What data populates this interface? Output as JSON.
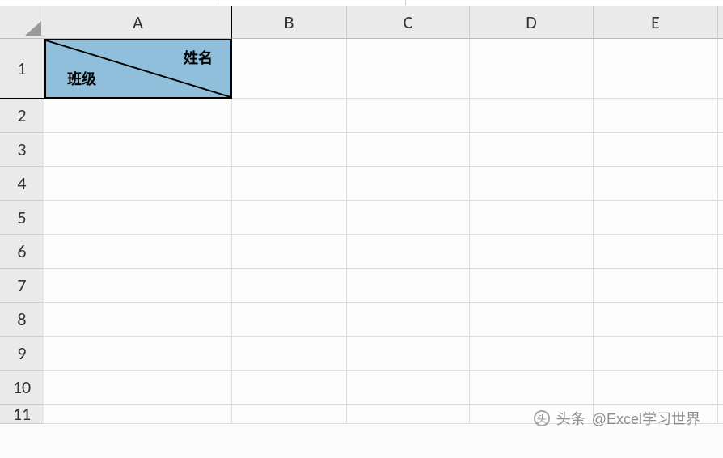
{
  "columns": [
    "A",
    "B",
    "C",
    "D",
    "E"
  ],
  "rows": [
    "1",
    "2",
    "3",
    "4",
    "5",
    "6",
    "7",
    "8",
    "9",
    "10",
    "11"
  ],
  "cell_a1": {
    "top_right_label": "姓名",
    "bottom_left_label": "班级",
    "fill_color": "#8fbfda"
  },
  "watermark": {
    "prefix": "头条",
    "handle": "@Excel学习世界"
  }
}
